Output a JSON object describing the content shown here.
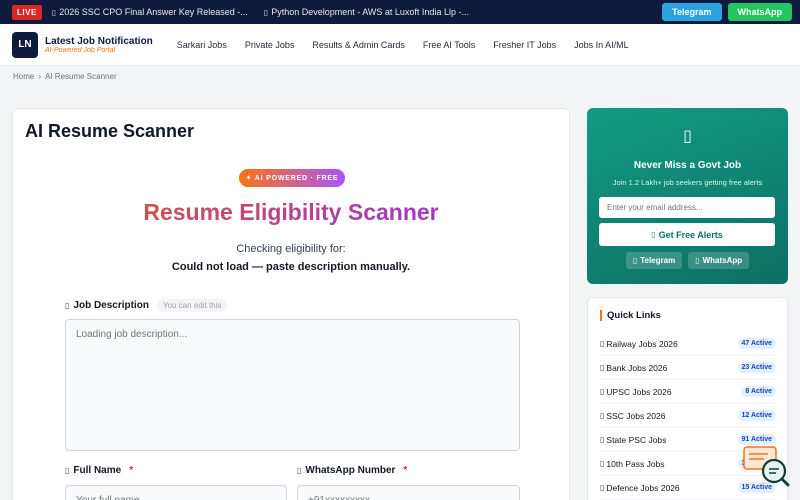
{
  "ticker": {
    "live": "LIVE",
    "items": [
      "2026 SSC CPO Final Answer Key Released -...",
      "Python Development - AWS at Luxoft India Llp -..."
    ],
    "telegram": "Telegram",
    "whatsapp": "WhatsApp"
  },
  "header": {
    "logo_text": "LN",
    "brand": "Latest Job Notification",
    "tagline": "AI-Powered Job Portal",
    "nav": [
      "Sarkari Jobs",
      "Private Jobs",
      "Results & Admin Cards",
      "Free AI Tools",
      "Fresher IT Jobs",
      "Jobs In AI/ML"
    ]
  },
  "breadcrumb": {
    "home": "Home",
    "sep": "›",
    "current": "AI Resume Scanner"
  },
  "main": {
    "title": "AI Resume Scanner",
    "badge": "✦ AI POWERED · FREE",
    "hero": "Resume Eligibility Scanner",
    "checking": "Checking eligibility for:",
    "load_msg": "Could not load — paste description manually.",
    "job_desc_label": "Job Description",
    "edit_hint": "You can edit this",
    "job_desc_placeholder": "Loading job description...",
    "full_name_label": "Full Name",
    "full_name_placeholder": "Your full name",
    "whatsapp_label": "WhatsApp Number",
    "whatsapp_placeholder": "+91xxxxxxxxx",
    "required": "*"
  },
  "alerts": {
    "title": "Never Miss a Govt Job",
    "subtitle": "Join 1.2 Lakh+ job seekers getting free alerts",
    "email_placeholder": "Enter your email address...",
    "cta": "Get Free Alerts",
    "telegram": "Telegram",
    "whatsapp": "WhatsApp"
  },
  "quick_links": {
    "title": "Quick Links",
    "items": [
      {
        "name": "Railway Jobs 2026",
        "count": "47 Active"
      },
      {
        "name": "Bank Jobs 2026",
        "count": "23 Active"
      },
      {
        "name": "UPSC Jobs 2026",
        "count": "8 Active"
      },
      {
        "name": "SSC Jobs 2026",
        "count": "12 Active"
      },
      {
        "name": "State PSC Jobs",
        "count": "91 Active"
      },
      {
        "name": "10th Pass Jobs",
        "count": "34 Active"
      },
      {
        "name": "Defence Jobs 2026",
        "count": "15 Active"
      }
    ]
  },
  "icons": {
    "glyph": "▯"
  },
  "colors": {
    "navy": "#0f1b3d",
    "accent": "#f97316",
    "teal": "#129b82",
    "purple": "#9333ea"
  }
}
